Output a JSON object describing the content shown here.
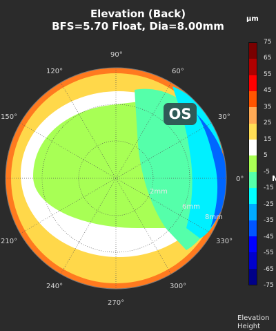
{
  "title": {
    "line1": "Elevation (Back)",
    "line2": "BFS=5.70 Float, Dia=8.00mm"
  },
  "eye_label": "OS",
  "units": "µm",
  "side_mark": "N",
  "footer": "Elevation\nHeight",
  "angle_labels": [
    "0°",
    "30°",
    "60°",
    "90°",
    "120°",
    "150°",
    "210°",
    "240°",
    "270°",
    "300°",
    "330°"
  ],
  "ring_labels": [
    "2mm",
    "6mm",
    "8mm"
  ],
  "scale": {
    "ticks": [
      "75",
      "65",
      "55",
      "45",
      "35",
      "25",
      "15",
      "5",
      "-5",
      "-15",
      "-25",
      "-35",
      "-45",
      "-55",
      "-65",
      "-75"
    ],
    "colors": [
      "#7a0000",
      "#b00000",
      "#ff0000",
      "#ff5500",
      "#ffaa55",
      "#ffdd55",
      "#ffffff",
      "#aaff55",
      "#55ffaa",
      "#00ffff",
      "#00aaff",
      "#0055ff",
      "#0000ff",
      "#0000cc",
      "#000088"
    ]
  },
  "map_colors": {
    "outer_orange": "#ff7a1f",
    "yellow": "#ffd84a",
    "white": "#ffffff",
    "green": "#a8ff55",
    "teal": "#55ffaa",
    "cyan": "#00f0ff",
    "blue": "#0066ff"
  }
}
